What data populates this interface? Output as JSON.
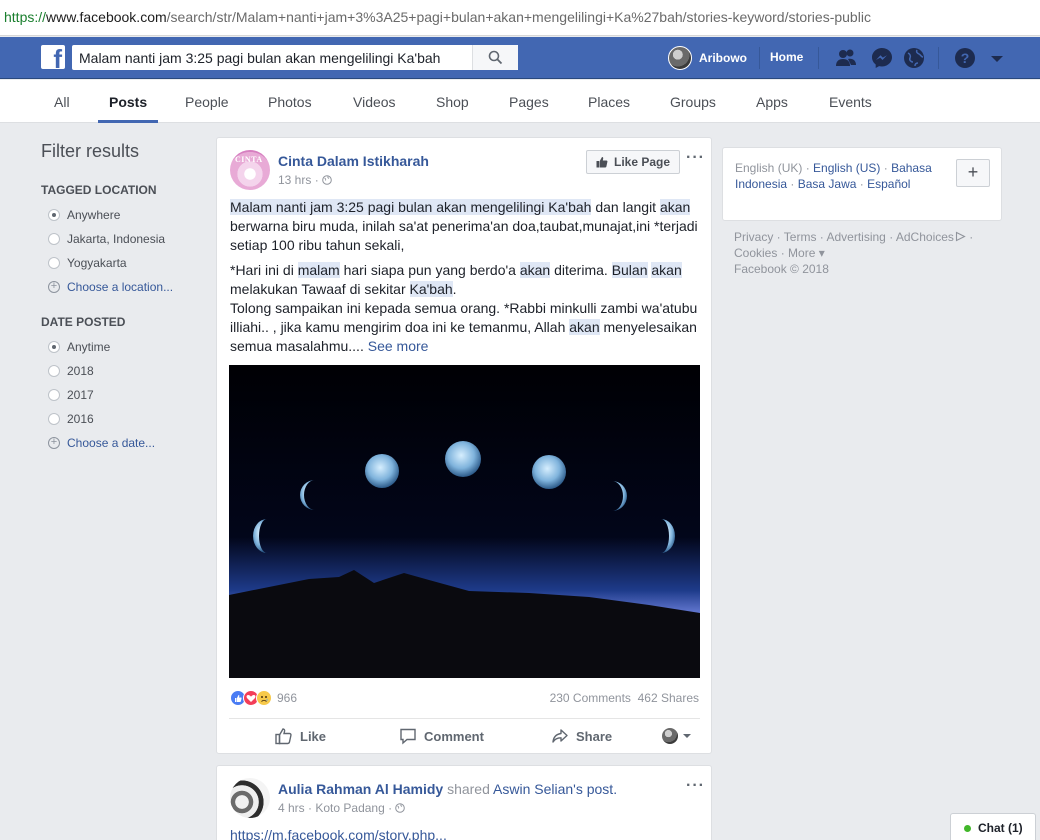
{
  "browser": {
    "url_protocol": "https://",
    "url_host": "www.facebook.com",
    "url_path": "/search/str/Malam+nanti+jam+3%3A25+pagi+bulan+akan+mengelilingi+Ka%27bah/stories-keyword/stories-public"
  },
  "topbar": {
    "logo": "f",
    "search_value": "Malam nanti jam 3:25 pagi bulan akan mengelilingi Ka'bah",
    "user_name": "Aribowo",
    "home_label": "Home"
  },
  "tabs": [
    {
      "label": "All",
      "active": false
    },
    {
      "label": "Posts",
      "active": true
    },
    {
      "label": "People",
      "active": false
    },
    {
      "label": "Photos",
      "active": false
    },
    {
      "label": "Videos",
      "active": false
    },
    {
      "label": "Shop",
      "active": false
    },
    {
      "label": "Pages",
      "active": false
    },
    {
      "label": "Places",
      "active": false
    },
    {
      "label": "Groups",
      "active": false
    },
    {
      "label": "Apps",
      "active": false
    },
    {
      "label": "Events",
      "active": false
    }
  ],
  "filters": {
    "title": "Filter results",
    "location_title": "TAGGED LOCATION",
    "location_options": [
      "Anywhere",
      "Jakarta, Indonesia",
      "Yogyakarta"
    ],
    "location_choose": "Choose a location...",
    "date_title": "DATE POSTED",
    "date_options": [
      "Anytime",
      "2018",
      "2017",
      "2016"
    ],
    "date_choose": "Choose a date..."
  },
  "post1": {
    "avatar_text": "CINTA",
    "author": "Cinta Dalam Istikharah",
    "time": "13 hrs",
    "like_page": "Like Page",
    "p1_a": "Malam nanti jam 3:25 pagi bulan akan mengelilingi Ka'bah",
    "p1_b": " dan langit ",
    "p1_c": "akan",
    "p1_d": " berwarna biru muda, inilah sa'at penerima'an doa,taubat,munajat,ini *terjadi setiap 100 ribu tahun sekali,",
    "p2_a": "*Hari ini di ",
    "p2_b": "malam",
    "p2_c": " hari siapa pun yang berdo'a ",
    "p2_d": "akan",
    "p2_e": " diterima. ",
    "p2_f": "Bulan",
    "p2_g": " ",
    "p2_h": "akan",
    "p2_i": " melakukan Tawaaf di sekitar ",
    "p2_j": "Ka'bah",
    "p2_k": ".",
    "p3_a": "Tolong sampaikan ini kepada semua orang. *Rabbi minkulli zambi wa'atubu illiahi.. , jika kamu mengirim doa ini ke temanmu, Allah ",
    "p3_b": "akan",
    "p3_c": " menyelesaikan semua masalahmu.... ",
    "see_more": "See more",
    "reaction_count": "966",
    "comments": "230 Comments",
    "shares": "462 Shares",
    "action_like": "Like",
    "action_comment": "Comment",
    "action_share": "Share"
  },
  "post2": {
    "author": "Aulia Rahman Al Hamidy",
    "shared_word": " shared ",
    "original_author": "Aswin Selian",
    "post_suffix": "'s post.",
    "time": "4 hrs",
    "location": "Koto Padang",
    "link": "https://m.facebook.com/story.php..."
  },
  "sidebar": {
    "lang_current": "English (UK)",
    "lang_others": [
      "English (US)",
      "Bahasa Indonesia",
      "Basa Jawa",
      "Español"
    ],
    "footer": [
      "Privacy",
      "Terms",
      "Advertising",
      "AdChoices",
      "Cookies",
      "More",
      "Facebook © 2018"
    ]
  },
  "chat": {
    "label": "Chat (1)"
  },
  "colors": {
    "brand": "#4267b2",
    "link": "#365899",
    "highlight": "#dfe7f5"
  }
}
